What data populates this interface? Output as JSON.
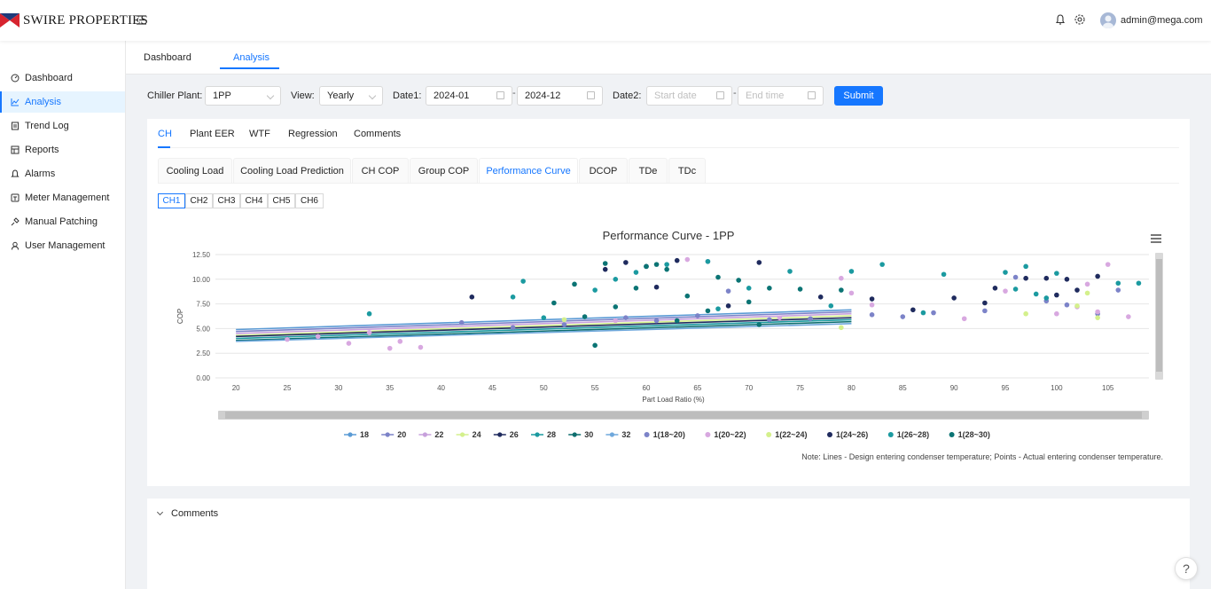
{
  "header": {
    "brand": "SWIRE PROPERTIES",
    "user": "admin@mega.com"
  },
  "sidebar": {
    "items": [
      {
        "label": "Dashboard",
        "icon": "dashboard-icon"
      },
      {
        "label": "Analysis",
        "icon": "chart-icon",
        "active": true
      },
      {
        "label": "Trend Log",
        "icon": "trend-log-icon"
      },
      {
        "label": "Reports",
        "icon": "reports-icon"
      },
      {
        "label": "Alarms",
        "icon": "bell-icon"
      },
      {
        "label": "Meter Management",
        "icon": "meter-icon"
      },
      {
        "label": "Manual Patching",
        "icon": "pin-icon"
      },
      {
        "label": "User Management",
        "icon": "user-icon"
      }
    ]
  },
  "top_tabs": [
    {
      "label": "Dashboard"
    },
    {
      "label": "Analysis",
      "active": true
    }
  ],
  "filters": {
    "chiller_plant_label": "Chiller Plant:",
    "chiller_plant_value": "1PP",
    "view_label": "View:",
    "view_value": "Yearly",
    "date1_label": "Date1:",
    "date1_start": "2024-01",
    "date1_end": "2024-12",
    "date2_label": "Date2:",
    "date2_start_placeholder": "Start date",
    "date2_end_placeholder": "End time",
    "submit_label": "Submit"
  },
  "sub_tabs": [
    {
      "label": "CH",
      "active": true
    },
    {
      "label": "Plant EER"
    },
    {
      "label": "WTF"
    },
    {
      "label": "Regression"
    },
    {
      "label": "Comments"
    }
  ],
  "chart_tabs": [
    {
      "label": "Cooling Load"
    },
    {
      "label": "Cooling Load Prediction"
    },
    {
      "label": "CH COP"
    },
    {
      "label": "Group COP"
    },
    {
      "label": "Performance Curve",
      "active": true
    },
    {
      "label": "DCOP"
    },
    {
      "label": "TDe"
    },
    {
      "label": "TDc"
    }
  ],
  "chillers": [
    {
      "label": "CH1",
      "active": true
    },
    {
      "label": "CH2"
    },
    {
      "label": "CH3"
    },
    {
      "label": "CH4"
    },
    {
      "label": "CH5"
    },
    {
      "label": "CH6"
    }
  ],
  "chart_data": {
    "type": "scatter",
    "title": "Performance Curve - 1PP",
    "xlabel": "Part Load Ratio (%)",
    "ylabel": "COP",
    "xlim": [
      18,
      109
    ],
    "ylim": [
      0,
      12.5
    ],
    "x_ticks": [
      20,
      25,
      30,
      35,
      40,
      45,
      50,
      55,
      60,
      65,
      70,
      75,
      80,
      85,
      90,
      95,
      100,
      105
    ],
    "y_ticks": [
      "0.00",
      "2.50",
      "5.00",
      "7.50",
      "10.00",
      "12.50"
    ],
    "grid": true,
    "legend_position": "bottom",
    "lines": [
      {
        "name": "18",
        "color": "#5b9bd5",
        "x": [
          20,
          80
        ],
        "y": [
          4.9,
          6.9
        ]
      },
      {
        "name": "20",
        "color": "#7c83c8",
        "x": [
          20,
          80
        ],
        "y": [
          4.7,
          6.7
        ]
      },
      {
        "name": "22",
        "color": "#c7a0dc",
        "x": [
          20,
          80
        ],
        "y": [
          4.5,
          6.5
        ]
      },
      {
        "name": "24",
        "color": "#d4f08c",
        "x": [
          20,
          80
        ],
        "y": [
          4.3,
          6.3
        ]
      },
      {
        "name": "26",
        "color": "#1f2b5e",
        "x": [
          20,
          80
        ],
        "y": [
          4.2,
          6.1
        ]
      },
      {
        "name": "28",
        "color": "#1b9aa0",
        "x": [
          20,
          80
        ],
        "y": [
          4.0,
          5.9
        ]
      },
      {
        "name": "30",
        "color": "#0e6e6e",
        "x": [
          20,
          80
        ],
        "y": [
          3.8,
          5.7
        ]
      },
      {
        "name": "32",
        "color": "#6fa8dc",
        "x": [
          20,
          80
        ],
        "y": [
          3.7,
          5.5
        ]
      }
    ],
    "points": [
      {
        "name": "1(18~20)",
        "color": "#7c83c8",
        "x": [
          42,
          58,
          65,
          68,
          72,
          85,
          88,
          96,
          101,
          104,
          106,
          76,
          61,
          52,
          47,
          82,
          93,
          99
        ],
        "y": [
          5.6,
          6.1,
          6.3,
          8.8,
          5.9,
          6.2,
          6.6,
          10.2,
          7.4,
          6.5,
          8.9,
          6.0,
          5.8,
          5.4,
          5.1,
          6.4,
          6.8,
          7.8
        ]
      },
      {
        "name": "1(20~22)",
        "color": "#d8a8e0",
        "x": [
          25,
          28,
          31,
          33,
          35,
          36,
          38,
          57,
          64,
          66,
          73,
          79,
          80,
          95,
          100,
          102,
          103,
          104,
          105,
          107,
          82,
          91
        ],
        "y": [
          3.9,
          4.2,
          3.5,
          4.6,
          3.0,
          3.7,
          3.1,
          5.8,
          12.0,
          11.8,
          6.1,
          10.1,
          8.6,
          8.8,
          6.5,
          7.2,
          9.5,
          6.7,
          11.5,
          6.2,
          7.4,
          6.0
        ]
      },
      {
        "name": "1(22~24)",
        "color": "#d4f08c",
        "x": [
          52,
          97,
          102,
          103,
          104,
          79
        ],
        "y": [
          5.9,
          6.5,
          7.3,
          8.6,
          6.1,
          5.1
        ]
      },
      {
        "name": "1(24~26)",
        "color": "#1f2b5e",
        "x": [
          43,
          56,
          58,
          60,
          63,
          71,
          77,
          82,
          90,
          94,
          97,
          99,
          100,
          101,
          102,
          104,
          61,
          68,
          86,
          93
        ],
        "y": [
          8.2,
          11.0,
          11.7,
          11.3,
          11.9,
          11.7,
          8.2,
          8.0,
          8.1,
          9.1,
          10.1,
          10.1,
          8.4,
          10.0,
          8.9,
          10.3,
          9.2,
          7.3,
          6.9,
          7.6
        ]
      },
      {
        "name": "1(26~28)",
        "color": "#1b9aa0",
        "x": [
          33,
          47,
          48,
          50,
          55,
          59,
          62,
          66,
          70,
          74,
          80,
          83,
          89,
          95,
          96,
          97,
          98,
          99,
          100,
          106,
          108,
          57,
          67,
          78,
          87
        ],
        "y": [
          6.5,
          8.2,
          9.8,
          6.1,
          8.9,
          10.7,
          11.5,
          11.8,
          9.1,
          10.8,
          10.8,
          11.5,
          10.5,
          10.7,
          9.0,
          11.3,
          8.5,
          8.1,
          10.6,
          9.6,
          9.6,
          10.0,
          7.0,
          7.3,
          6.6
        ]
      },
      {
        "name": "1(28~30)",
        "color": "#0b7474",
        "x": [
          53,
          55,
          56,
          57,
          59,
          60,
          61,
          62,
          64,
          67,
          69,
          70,
          72,
          75,
          79,
          54,
          51,
          63,
          66,
          71
        ],
        "y": [
          9.5,
          3.3,
          11.6,
          7.2,
          9.1,
          11.3,
          11.5,
          11.0,
          8.3,
          10.2,
          9.9,
          7.7,
          9.1,
          9.0,
          8.9,
          6.2,
          7.6,
          5.8,
          6.8,
          5.4
        ]
      }
    ]
  },
  "note": "Note: Lines - Design entering condenser temperature; Points - Actual entering condenser temperature.",
  "comments_title": "Comments",
  "help_label": "?"
}
